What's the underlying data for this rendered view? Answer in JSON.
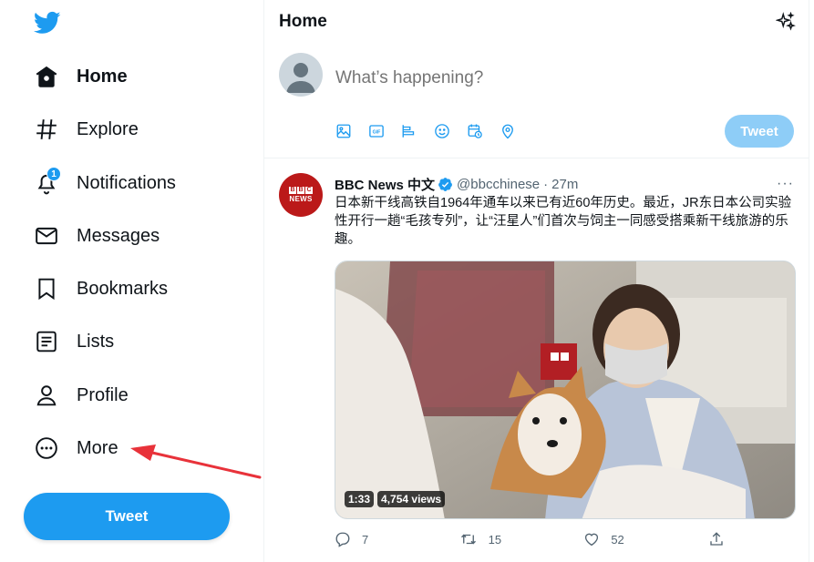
{
  "colors": {
    "accent": "#1d9bf0",
    "accent_disabled": "#8ecdf7",
    "annotation_arrow": "#e8323a",
    "bbc_red": "#bb1919"
  },
  "sidebar": {
    "logo_icon": "twitter-bird-icon",
    "items": [
      {
        "label": "Home",
        "icon": "home-icon",
        "active": true
      },
      {
        "label": "Explore",
        "icon": "hashtag-icon"
      },
      {
        "label": "Notifications",
        "icon": "bell-icon",
        "badge": "1"
      },
      {
        "label": "Messages",
        "icon": "envelope-icon"
      },
      {
        "label": "Bookmarks",
        "icon": "bookmark-icon"
      },
      {
        "label": "Lists",
        "icon": "list-icon"
      },
      {
        "label": "Profile",
        "icon": "person-icon"
      },
      {
        "label": "More",
        "icon": "more-circle-icon"
      }
    ],
    "tweet_button": "Tweet"
  },
  "header": {
    "title": "Home",
    "icon": "sparkle-icon"
  },
  "composer": {
    "placeholder": "What’s happening?",
    "tools": [
      "image-icon",
      "gif-icon",
      "poll-icon",
      "emoji-icon",
      "schedule-icon",
      "location-icon"
    ],
    "tweet_button": "Tweet"
  },
  "tweet": {
    "author_name": "BBC News 中文",
    "avatar_letters": [
      "B",
      "B",
      "C"
    ],
    "avatar_word": "NEWS",
    "handle": "@bbcchinese",
    "separator": "·",
    "time": "27m",
    "more": "···",
    "text": "日本新干线高铁自1964年通车以来已有近60年历史。最近，JR东日本公司实验性开行一趟“毛孩专列”，让“汪星人”们首次与饲主一同感受搭乘新干线旅游的乐趣。",
    "media": {
      "duration": "1:33",
      "views": "4,754 views"
    },
    "actions": {
      "replies": "7",
      "retweets": "15",
      "likes": "52"
    }
  }
}
